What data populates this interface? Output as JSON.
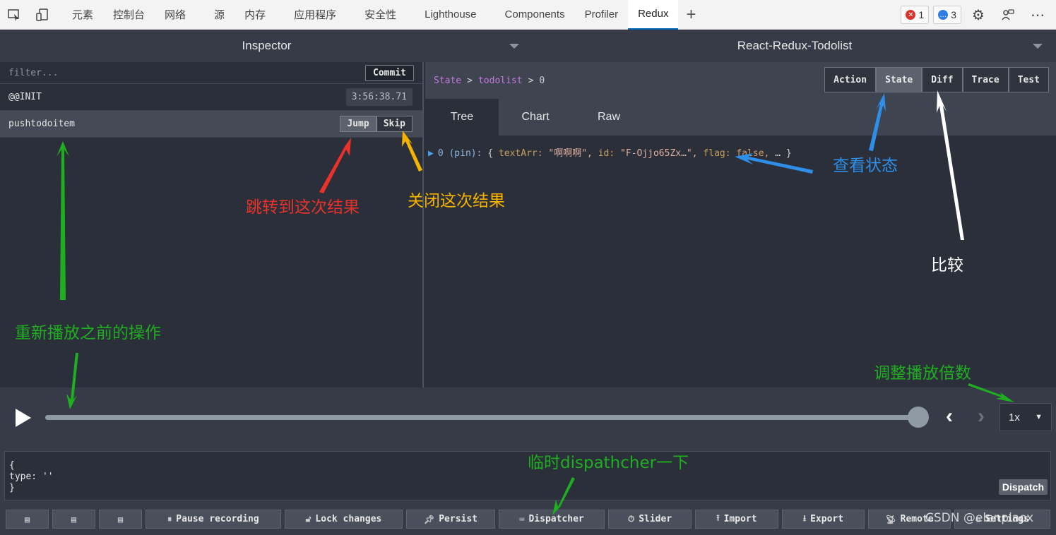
{
  "devtools": {
    "tabs": [
      "元素",
      "控制台",
      "网络",
      "源",
      "内存",
      "应用程序",
      "安全性",
      "Lighthouse",
      "Components",
      "Profiler",
      "Redux"
    ],
    "active_tab": "Redux",
    "error_count": "1",
    "message_count": "3",
    "colors": {
      "error": "#d9332b",
      "message": "#2f7de1",
      "active_underline": "#0067b8"
    }
  },
  "panel": {
    "left_title": "Inspector",
    "right_title": "React-Redux-Todolist"
  },
  "actions": {
    "filter_placeholder": "filter...",
    "commit_label": "Commit",
    "items": [
      {
        "name": "@@INIT",
        "time": "3:56:38.71"
      },
      {
        "name": "pushtodoitem",
        "jump": "Jump",
        "skip": "Skip"
      }
    ]
  },
  "state_view": {
    "breadcrumb": [
      "State",
      "todolist",
      "0"
    ],
    "modes": [
      "Action",
      "State",
      "Diff",
      "Trace",
      "Test"
    ],
    "active_mode": "State",
    "tabs": [
      "Tree",
      "Chart",
      "Raw"
    ],
    "active_tab": "Tree",
    "tree": {
      "key": "0 (pin):",
      "open": "{",
      "f1_key": "textArr:",
      "f1_val": "\"啊啊啊\",",
      "f2_key": "id:",
      "f2_val": "\"F-Ojjo65Zx…\",",
      "f3_key": "flag:",
      "f3_val": "false,",
      "rest": "… }"
    }
  },
  "slider": {
    "position": 1.0,
    "speed": "1x"
  },
  "dispatcher": {
    "text": "{\ntype: ''\n}",
    "button": "Dispatch"
  },
  "toolbar": {
    "pause": "Pause recording",
    "lock": "Lock changes",
    "persist": "Persist",
    "dispatcher": "Dispatcher",
    "slider": "Slider",
    "import": "Import",
    "export": "Export",
    "remote": "Remote",
    "settings": "Settings"
  },
  "annotations": {
    "jump": "跳转到这次结果",
    "skip": "关闭这次结果",
    "state": "查看状态",
    "diff": "比较",
    "replay": "重新播放之前的操作",
    "speed": "调整播放倍数",
    "dispatch": "临时dispathcher一下",
    "colors": {
      "red": "#e8322a",
      "orange": "#f5b300",
      "blue": "#2f8fe8",
      "white": "#ffffff",
      "green": "#1fae1f"
    }
  },
  "watermark": "CSDN @elenpiaox"
}
